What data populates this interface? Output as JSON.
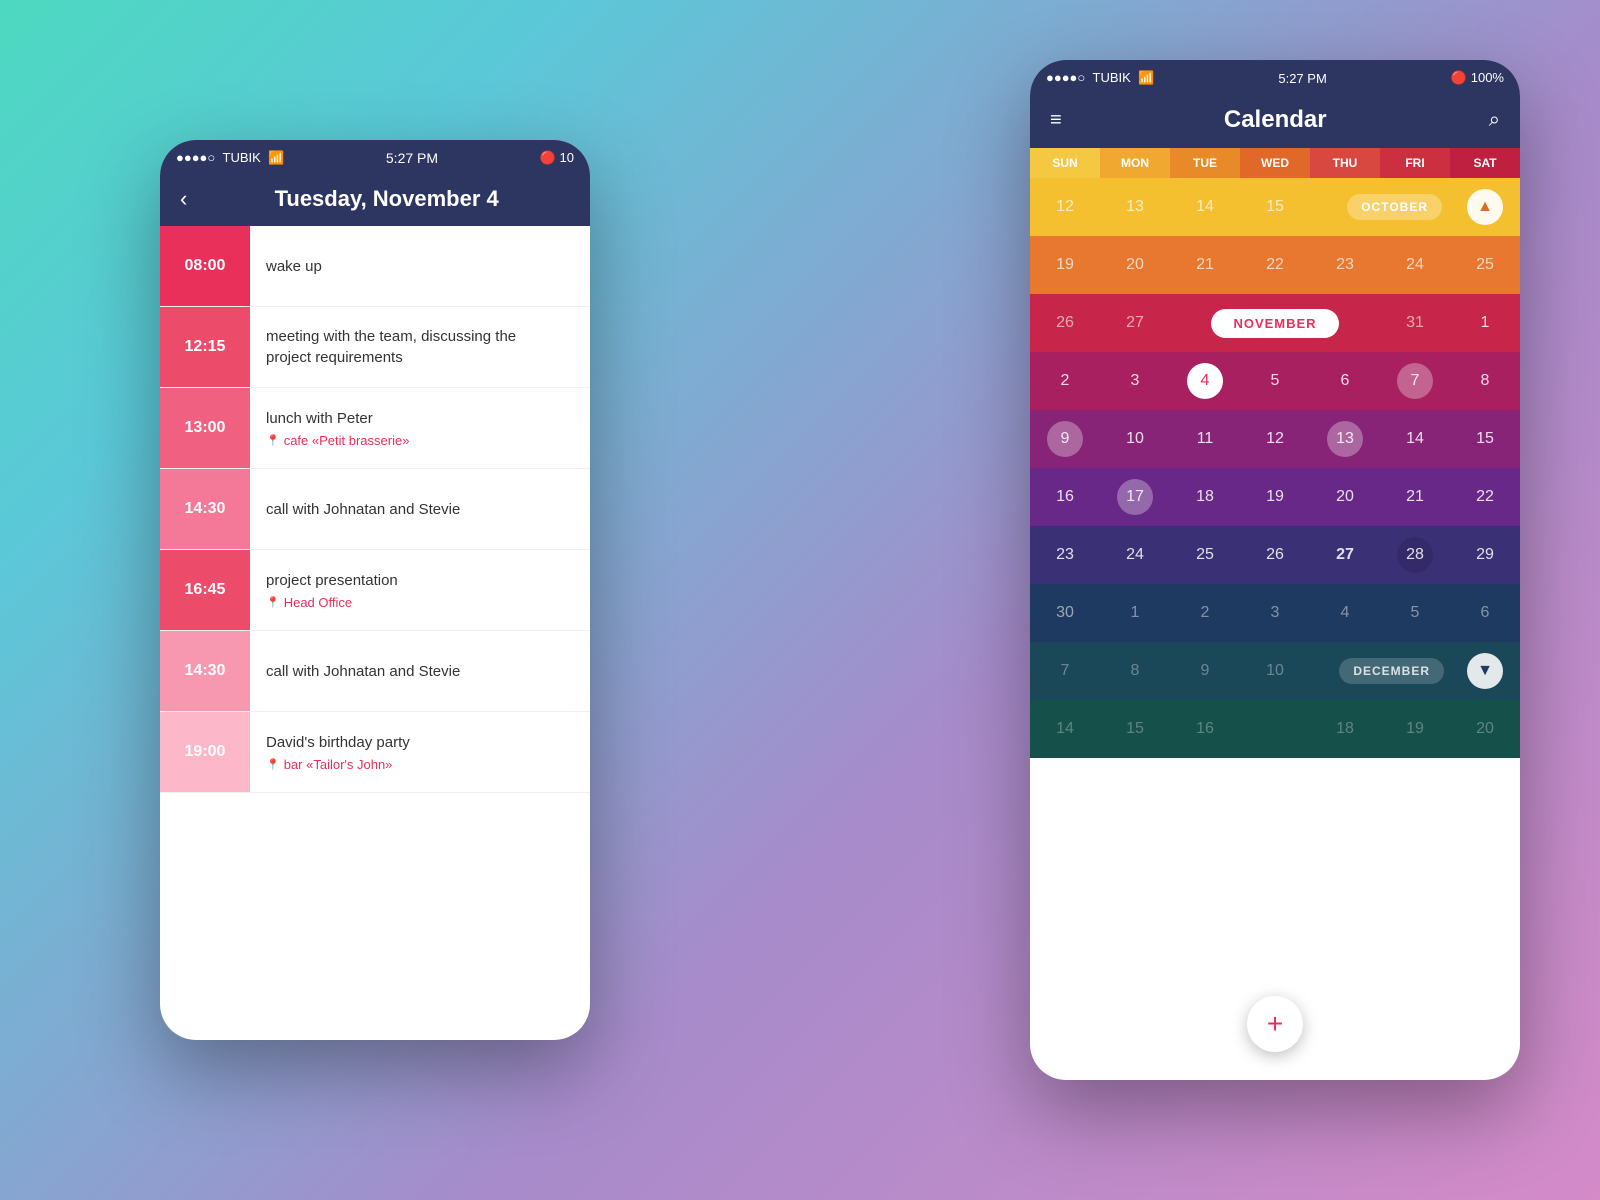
{
  "background": {
    "gradient": "linear-gradient(135deg, #4dd9c0 0%, #5bc8d8 20%, #a78bca 60%, #d48bc8 100%)"
  },
  "left_phone": {
    "status_bar": {
      "dots": "●●●●○",
      "carrier": "TUBIK",
      "wifi": "wifi",
      "time": "5:27 PM",
      "bluetooth": "bluetooth",
      "battery": "10"
    },
    "header": {
      "back_label": "‹",
      "title": "Tuesday, November 4"
    },
    "events": [
      {
        "time": "08:00",
        "title": "wake up",
        "location": ""
      },
      {
        "time": "12:15",
        "title": "meeting with the team, discussing the project requirements",
        "location": ""
      },
      {
        "time": "13:00",
        "title": "lunch with Peter",
        "location": "cafe «Petit brasserie»"
      },
      {
        "time": "14:30",
        "title": "call with Johnatan and Stevie",
        "location": ""
      },
      {
        "time": "16:45",
        "title": "project presentation",
        "location": "Head Office"
      },
      {
        "time": "14:30",
        "title": "call with Johnatan and Stevie",
        "location": ""
      },
      {
        "time": "19:00",
        "title": "David's birthday party",
        "location": "bar «Tailor's John»"
      }
    ]
  },
  "right_phone": {
    "status_bar": {
      "dots": "●●●●○",
      "carrier": "TUBIK",
      "wifi": "wifi",
      "time": "5:27 PM",
      "bluetooth": "bluetooth",
      "battery": "100%"
    },
    "nav_bar": {
      "menu_label": "≡",
      "title": "Calendar",
      "search_label": "⌕"
    },
    "day_headers": [
      "SUN",
      "MON",
      "TUE",
      "WED",
      "THU",
      "FRI",
      "SAT"
    ],
    "october": {
      "label": "OCTOBER",
      "row1": [
        "12",
        "13",
        "14",
        "15",
        "",
        "",
        ""
      ],
      "row2": [
        "19",
        "20",
        "21",
        "22",
        "23",
        "24",
        "25"
      ]
    },
    "november": {
      "label": "NOVEMBER",
      "row1": [
        "26",
        "27",
        "",
        "",
        "31",
        "",
        "1"
      ],
      "week1": [
        "2",
        "3",
        "4",
        "5",
        "6",
        "7",
        "8"
      ],
      "week2": [
        "9",
        "10",
        "11",
        "12",
        "13",
        "14",
        "15"
      ],
      "week3": [
        "16",
        "17",
        "18",
        "19",
        "20",
        "21",
        "22"
      ],
      "week4": [
        "23",
        "24",
        "25",
        "26",
        "27",
        "28",
        "29"
      ],
      "week5": [
        "30",
        "",
        "",
        "",
        "",
        "",
        ""
      ]
    },
    "december": {
      "label": "DECEMBER",
      "row1": [
        "",
        "1",
        "2",
        "3",
        "4",
        "5",
        "6"
      ],
      "row2": [
        "7",
        "8",
        "9",
        "10",
        "",
        "",
        ""
      ],
      "row3": [
        "14",
        "15",
        "16",
        "",
        "18",
        "19",
        "20"
      ]
    },
    "fab_label": "+"
  }
}
